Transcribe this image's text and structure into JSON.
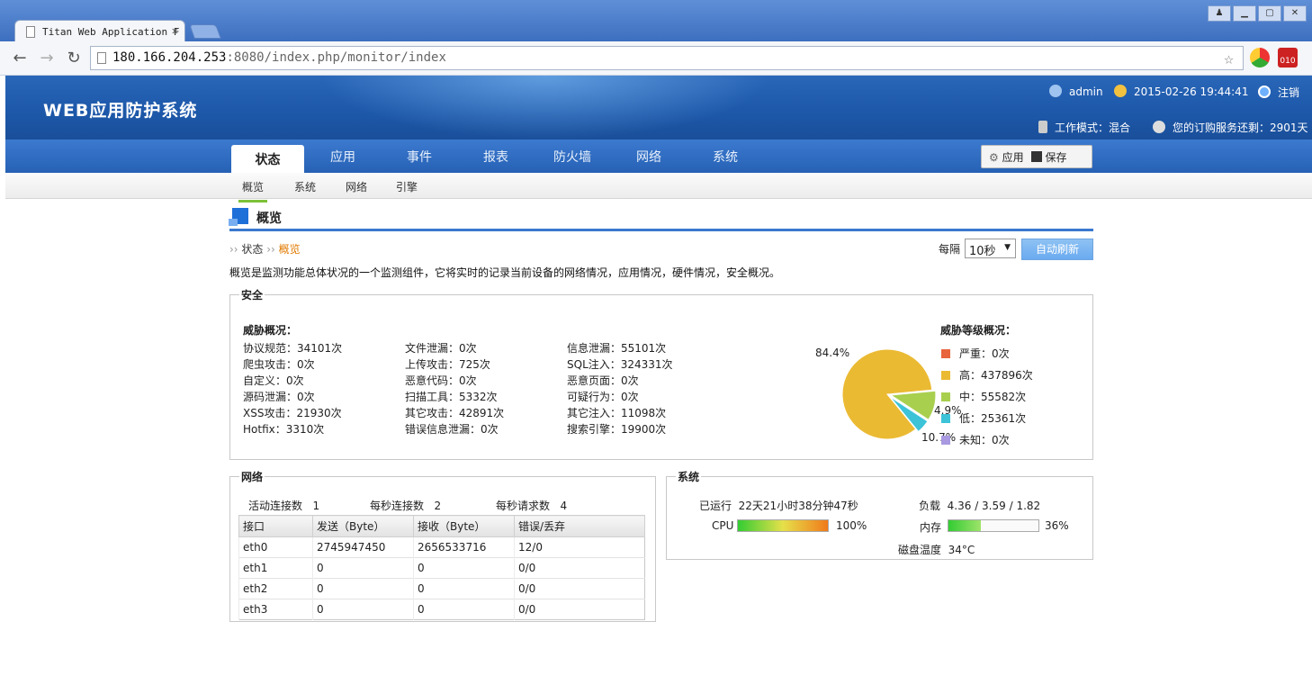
{
  "browser": {
    "tab_title": "Titan Web Application F",
    "url_host": "180.166.204.253",
    "url_rest": ":8080/index.php/monitor/index"
  },
  "header": {
    "app_title": "WEB应用防护系统",
    "user": "admin",
    "datetime": "2015-02-26  19:44:41",
    "logout": "注销",
    "work_mode": "工作模式：混合",
    "subscription": "您的订购服务还剩：2901天"
  },
  "nav": {
    "tabs": [
      "状态",
      "应用",
      "事件",
      "报表",
      "防火墙",
      "网络",
      "系统"
    ],
    "apply": "应用",
    "save": "保存"
  },
  "subnav": [
    "概览",
    "系统",
    "网络",
    "引擎"
  ],
  "page": {
    "heading": "概览",
    "crumb_root": "状态",
    "crumb_current": "概览",
    "description": "概览是监测功能总体状况的一个监测组件，它将实时的记录当前设备的网络情况，应用情况，硬件情况，安全概况。",
    "interval_label": "每隔",
    "interval_value": "10秒",
    "refresh_button": "自动刷新"
  },
  "security": {
    "legend": "安全",
    "overview_title": "威胁概况：",
    "threats": [
      [
        "协议规范：34101次",
        "文件泄漏：0次",
        "信息泄漏：55101次"
      ],
      [
        "爬虫攻击：0次",
        "上传攻击：725次",
        "SQL注入：324331次"
      ],
      [
        "自定义：0次",
        "恶意代码：0次",
        "恶意页面：0次"
      ],
      [
        "源码泄漏：0次",
        "扫描工具：5332次",
        "可疑行为：0次"
      ],
      [
        "XSS攻击：21930次",
        "其它攻击：42891次",
        "其它注入：11098次"
      ],
      [
        "Hotfix：3310次",
        "错误信息泄漏：0次",
        "搜索引擎：19900次"
      ]
    ],
    "level_title": "威胁等级概况：",
    "levels": [
      {
        "label": "严重：0次",
        "color": "#e8643c"
      },
      {
        "label": "高：437896次",
        "color": "#ebba33"
      },
      {
        "label": "中：55582次",
        "color": "#a9cf4f"
      },
      {
        "label": "低：25361次",
        "color": "#3cc3d8"
      },
      {
        "label": "未知：0次",
        "color": "#a899e0"
      }
    ]
  },
  "chart_data": {
    "type": "pie",
    "slices": [
      {
        "label": "高",
        "value": 84.4,
        "color": "#ebba33",
        "text": "84.4%"
      },
      {
        "label": "中",
        "value": 10.7,
        "color": "#a9cf4f",
        "text": "10.7%"
      },
      {
        "label": "低",
        "value": 4.9,
        "color": "#3cc3d8",
        "text": "4.9%"
      }
    ]
  },
  "network": {
    "legend": "网络",
    "active_conn_label": "活动连接数",
    "active_conn": "1",
    "conn_per_sec_label": "每秒连接数",
    "conn_per_sec": "2",
    "req_per_sec_label": "每秒请求数",
    "req_per_sec": "4",
    "columns": [
      "接口",
      "发送（Byte）",
      "接收（Byte）",
      "错误/丢弃"
    ],
    "rows": [
      [
        "eth0",
        "2745947450",
        "2656533716",
        "12/0"
      ],
      [
        "eth1",
        "0",
        "0",
        "0/0"
      ],
      [
        "eth2",
        "0",
        "0",
        "0/0"
      ],
      [
        "eth3",
        "0",
        "0",
        "0/0"
      ]
    ]
  },
  "system": {
    "legend": "系统",
    "uptime_label": "已运行",
    "uptime": "22天21小时38分钟47秒",
    "load_label": "负载",
    "load": "4.36 / 3.59 / 1.82",
    "cpu_label": "CPU",
    "cpu_text": "100%",
    "cpu_value": 1.0,
    "mem_label": "内存",
    "mem_text": "36%",
    "mem_value": 0.36,
    "disk_label": "磁盘温度",
    "disk": "34°C"
  }
}
